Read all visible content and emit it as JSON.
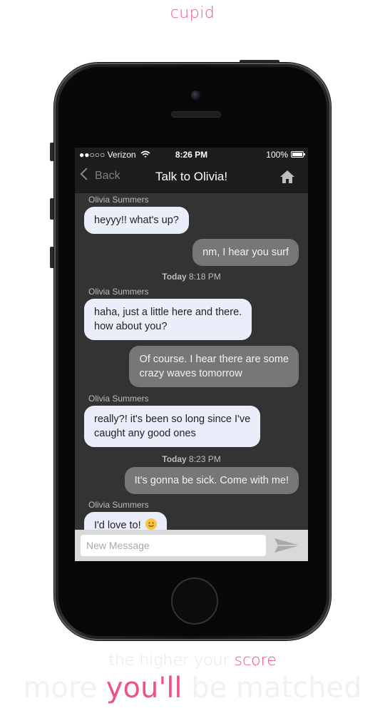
{
  "brand": "cupid",
  "status_bar": {
    "carrier": "●●○○○ Verizon",
    "time": "8:26 PM",
    "battery": "100%"
  },
  "nav": {
    "back_label": "Back",
    "title": "Talk to Olivia!"
  },
  "messages": [
    {
      "type": "sender",
      "text": "Olivia Summers"
    },
    {
      "type": "in",
      "text": "heyyy!! what's up?"
    },
    {
      "type": "out",
      "text": "nm, I hear you surf"
    },
    {
      "type": "stamp",
      "day": "Today",
      "time": "8:18 PM"
    },
    {
      "type": "sender",
      "text": "Olivia Summers"
    },
    {
      "type": "in",
      "line1": "haha, just a little here and there.",
      "line2": "how about you?"
    },
    {
      "type": "out",
      "line1": "Of course. I hear there are some",
      "line2": "crazy waves tomorrow"
    },
    {
      "type": "sender",
      "text": "Olivia Summers"
    },
    {
      "type": "in",
      "line1": "really?! it's been so long since I've",
      "line2": "caught any good ones"
    },
    {
      "type": "stamp",
      "day": "Today",
      "time": "8:23 PM"
    },
    {
      "type": "out",
      "text": "It's gonna be sick. Come with me!"
    },
    {
      "type": "sender",
      "text": "Olivia Summers"
    },
    {
      "type": "in",
      "text": "I'd love to!"
    }
  ],
  "input": {
    "placeholder": "New Message"
  },
  "tagline": {
    "line1_pre": "the higher your ",
    "line1_hl": "score",
    "line2_pre": "more ",
    "line2_hl": "you'll",
    "line2_post": " be matched"
  },
  "colors": {
    "accent": "#f0508a",
    "incoming_bubble": "#eaeefb",
    "outgoing_bubble": "#777777",
    "chat_bg": "#333333"
  },
  "icons": {
    "back": "chevron-left-icon",
    "home": "home-icon",
    "send": "send-icon",
    "wifi": "wifi-icon",
    "battery": "battery-icon"
  }
}
